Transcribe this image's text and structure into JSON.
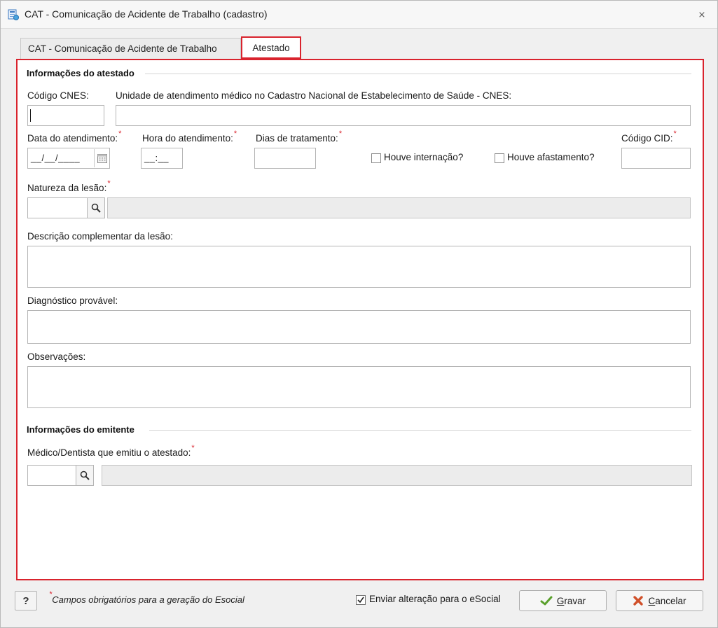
{
  "window": {
    "title": "CAT - Comunicação de Acidente de Trabalho (cadastro)",
    "close_glyph": "⨯"
  },
  "tabs": [
    {
      "label": "CAT - Comunicação de Acidente de Trabalho",
      "active": false
    },
    {
      "label": "Atestado",
      "active": true
    }
  ],
  "atestado": {
    "section_title": "Informações do atestado",
    "cnes_code_label": "Código CNES:",
    "cnes_unit_label": "Unidade de atendimento médico no Cadastro Nacional de Estabelecimento de Saúde - CNES:",
    "date_label": "Data do atendimento:",
    "date_mask": "__/__/____",
    "time_label": "Hora do atendimento:",
    "time_mask": "__:__",
    "days_label": "Dias de tratamento:",
    "hospitalization_label": "Houve internação?",
    "leave_label": "Houve afastamento?",
    "cid_label": "Código CID:",
    "injury_nature_label": "Natureza da lesão:",
    "injury_description_label": "Descrição complementar da lesão:",
    "diagnosis_label": "Diagnóstico provável:",
    "notes_label": "Observações:",
    "required_mark": "*"
  },
  "emitente": {
    "section_title": "Informações do emitente",
    "doctor_label": "Médico/Dentista que emitiu o atestado:"
  },
  "footer": {
    "help_label": "?",
    "required_note": "Campos obrigatórios para a geração do Esocial",
    "send_esocial_label": "Enviar alteração para o eSocial",
    "send_esocial_checked": true,
    "save_label": "Gravar",
    "cancel_label": "Cancelar"
  },
  "colors": {
    "highlight": "#d9232d",
    "required": "#d9232d",
    "save_check": "#5aa02c",
    "cancel_x": "#d0502a"
  }
}
